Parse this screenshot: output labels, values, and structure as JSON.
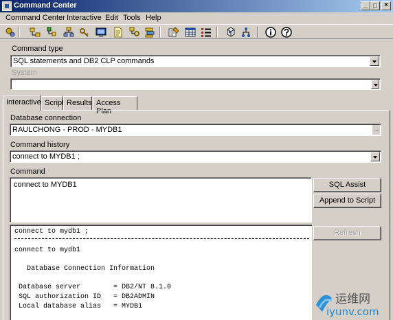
{
  "window": {
    "title": "Command Center"
  },
  "menu": [
    "Command Center",
    "Interactive",
    "Edit",
    "Tools",
    "Help"
  ],
  "toolbar": {
    "icons": [
      "db-connect-icon",
      "folder-tree-icon",
      "tree-icon",
      "network-icon",
      "key-icon",
      "monitor-icon",
      "document-icon",
      "key-tree-icon",
      "stack-icon",
      "edit-list-icon",
      "grid-icon",
      "list-icon",
      "cube-icon",
      "tree-branch-icon",
      "info-icon",
      "help-icon"
    ]
  },
  "command_type": {
    "label": "Command type",
    "value": "SQL statements and DB2 CLP commands"
  },
  "system": {
    "label": "System",
    "value": ""
  },
  "tabs": [
    {
      "label": "Interactive",
      "active": true
    },
    {
      "label": "Script",
      "active": false
    },
    {
      "label": "Results",
      "active": false
    },
    {
      "label": "Access Plan",
      "active": false
    }
  ],
  "database_connection": {
    "label": "Database connection",
    "value": "RAULCHONG - PROD - MYDB1",
    "browse": "..."
  },
  "command_history": {
    "label": "Command history",
    "value": "connect to MYDB1 ;"
  },
  "command": {
    "label": "Command",
    "text": "connect to MYDB1"
  },
  "buttons": {
    "sql_assist": "SQL Assist",
    "append_to_script": "Append to Script",
    "refresh": "Refresh"
  },
  "output": {
    "header": "connect to mydb1 ;",
    "lines": [
      "connect to mydb1",
      "   Database Connection Information",
      " Database server        = DB2/NT 8.1.0",
      " SQL authorization ID   = DB2ADMIN",
      " Local database alias   = MYDB1"
    ]
  },
  "watermark": {
    "brand": "运维网",
    "url": "iyunv.com"
  },
  "colors": {
    "face": "#d4d0c8",
    "title_start": "#0a246a",
    "title_end": "#a6caf0",
    "watermark_blue": "#1e88d6"
  }
}
